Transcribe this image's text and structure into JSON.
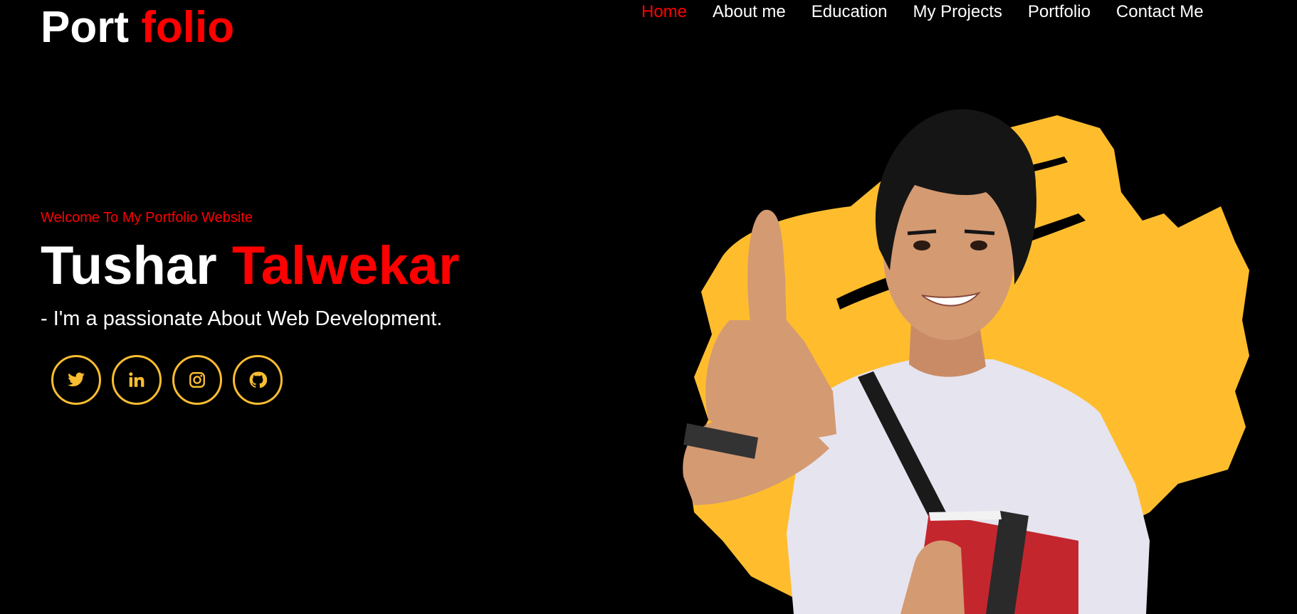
{
  "logo": {
    "part1": "Port ",
    "part2": "folio"
  },
  "nav": [
    {
      "label": "Home",
      "active": true
    },
    {
      "label": "About me",
      "active": false
    },
    {
      "label": "Education",
      "active": false
    },
    {
      "label": "My Projects",
      "active": false
    },
    {
      "label": "Portfolio",
      "active": false
    },
    {
      "label": "Contact Me",
      "active": false
    }
  ],
  "hero": {
    "welcome": "Welcome To My Portfolio Website",
    "first_name": "Tushar ",
    "last_name": "Talwekar",
    "tagline": "- I'm a passionate About Web Development."
  },
  "socials": [
    {
      "icon": "twitter-icon"
    },
    {
      "icon": "linkedin-icon"
    },
    {
      "icon": "instagram-icon"
    },
    {
      "icon": "github-icon"
    }
  ],
  "colors": {
    "background": "#000000",
    "accent_red": "#ff0000",
    "accent_yellow": "#f9bd30",
    "text": "#ffffff"
  }
}
